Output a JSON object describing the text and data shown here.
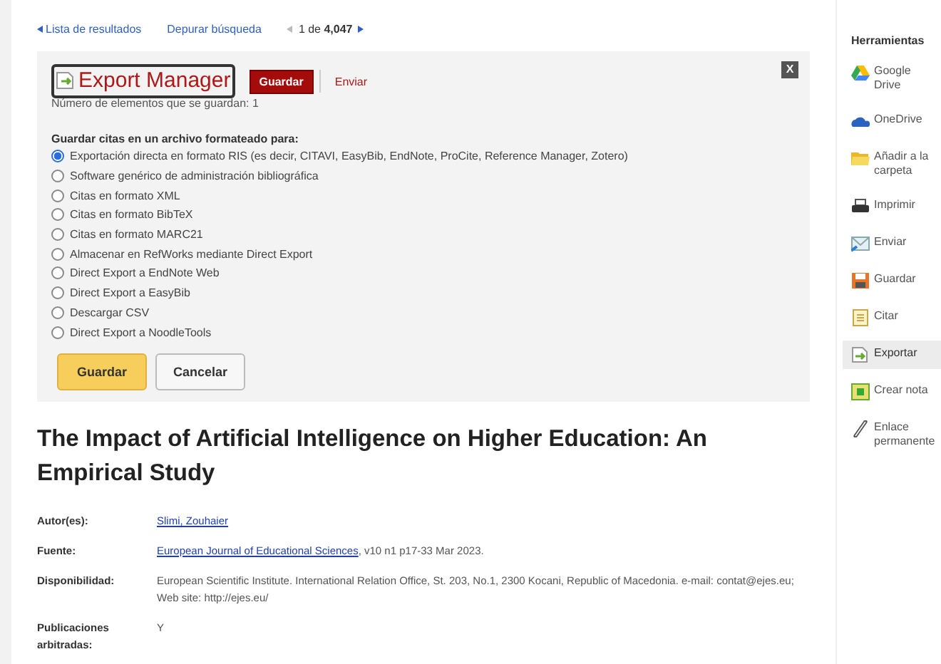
{
  "nav": {
    "back": "Lista de resultados",
    "refine": "Depurar búsqueda",
    "pager": "1 de **4,047**"
  },
  "export": {
    "title": "Export Manager",
    "tabs": [
      {
        "label": "Guardar",
        "selected": true
      },
      {
        "label": "Enviar",
        "selected": false
      }
    ],
    "close": "X",
    "count": "Número de elementos que se guardan: 1",
    "heading": "Guardar citas en un archivo formateado para:",
    "options": [
      {
        "label": "Exportación directa en formato RIS (es decir, CITAVI, EasyBib, EndNote, ProCite, Reference Manager, Zotero)",
        "selected": true
      },
      {
        "label": "Software genérico de administración bibliográfica",
        "selected": false
      },
      {
        "label": "Citas en formato XML",
        "selected": false
      },
      {
        "label": "Citas en formato BibTeX",
        "selected": false
      },
      {
        "label": "Citas en formato MARC21",
        "selected": false
      },
      {
        "label": "Almacenar en RefWorks mediante Direct Export",
        "selected": false
      },
      {
        "label": "Direct Export a EndNote Web",
        "selected": false
      },
      {
        "label": "Direct Export a EasyBib",
        "selected": false
      },
      {
        "label": "Descargar CSV",
        "selected": false
      },
      {
        "label": "Direct Export a NoodleTools",
        "selected": false
      }
    ],
    "buttons": [
      {
        "label": "Guardar",
        "kind": "primary"
      },
      {
        "label": "Cancelar",
        "kind": "secondary"
      }
    ]
  },
  "title": "The Impact of Artificial Intelligence on Higher Education: An Empirical Study",
  "details": [
    {
      "label": "Autor(es):",
      "value": [
        {
          "text": "Slimi, Zouhaier",
          "link": true
        }
      ]
    },
    {
      "label": "Fuente:",
      "value": [
        {
          "text": "European Journal of Educational Sciences",
          "link": true
        },
        {
          "text": ", v10 n1 p17-33 Mar 2023.",
          "link": false
        }
      ]
    },
    {
      "label": "Disponibilidad:",
      "value": [
        {
          "text": "European Scientific Institute. International Relation Office, St. 203, No.1, 2300 Kocani, Republic of Macedonia. e-mail: contat@ejes.eu; Web site: http://ejes.eu/",
          "link": false
        }
      ]
    },
    {
      "label": "Publicaciones arbitradas:",
      "value": [
        {
          "text": "Y",
          "link": false
        }
      ]
    }
  ],
  "sidebar": {
    "heading": "Herramientas",
    "items": [
      {
        "label": "Google Drive",
        "selected": false
      },
      {
        "label": "OneDrive",
        "selected": false
      },
      {
        "label": "Añadir a la carpeta",
        "selected": false
      },
      {
        "label": "Imprimir",
        "selected": false
      },
      {
        "label": "Enviar",
        "selected": false
      },
      {
        "label": "Guardar",
        "selected": false
      },
      {
        "label": "Citar",
        "selected": false
      },
      {
        "label": "Exportar",
        "selected": true
      },
      {
        "label": "Crear nota",
        "selected": false
      },
      {
        "label": "Enlace permanente",
        "selected": false
      }
    ]
  }
}
